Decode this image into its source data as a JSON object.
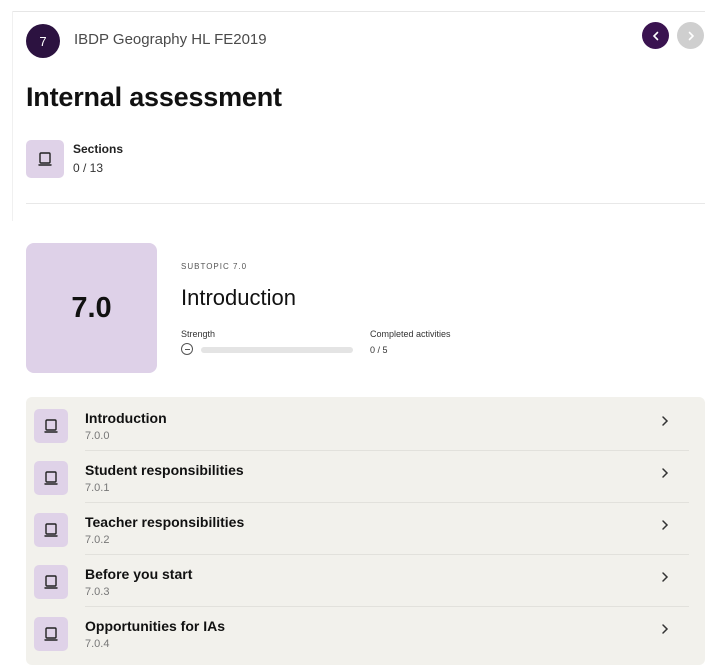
{
  "header": {
    "topic_number": "7",
    "course_title": "IBDP Geography HL FE2019",
    "prev_icon": "chevron-left-icon",
    "next_icon": "chevron-right-icon"
  },
  "page": {
    "title": "Internal assessment"
  },
  "sections": {
    "icon": "book-icon",
    "label": "Sections",
    "count": "0 / 13"
  },
  "subtopic": {
    "number": "7.0",
    "kicker": "SUBTOPIC 7.0",
    "title": "Introduction",
    "strength_label": "Strength",
    "strength_progress": 0,
    "completed_label": "Completed activities",
    "completed_value": "0 / 5"
  },
  "activities": [
    {
      "title": "Introduction",
      "number": "7.0.0"
    },
    {
      "title": "Student responsibilities",
      "number": "7.0.1"
    },
    {
      "title": "Teacher responsibilities",
      "number": "7.0.2"
    },
    {
      "title": "Before you start",
      "number": "7.0.3"
    },
    {
      "title": "Opportunities for IAs",
      "number": "7.0.4"
    }
  ],
  "colors": {
    "badge": "#2c1240",
    "accent_tile": "#ded1e8",
    "list_bg": "#f2f1ec"
  }
}
